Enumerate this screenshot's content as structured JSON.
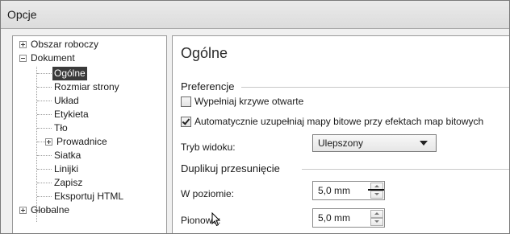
{
  "window": {
    "title": "Opcje"
  },
  "tree": {
    "items": [
      {
        "label": "Obszar roboczy",
        "expander": "plus"
      },
      {
        "label": "Dokument",
        "expander": "minus"
      },
      {
        "label": "Ogólne",
        "selected": true
      },
      {
        "label": "Rozmiar strony"
      },
      {
        "label": "Układ"
      },
      {
        "label": "Etykieta"
      },
      {
        "label": "Tło"
      },
      {
        "label": "Prowadnice",
        "expander": "plus"
      },
      {
        "label": "Siatka"
      },
      {
        "label": "Linijki"
      },
      {
        "label": "Zapisz"
      },
      {
        "label": "Eksportuj HTML"
      },
      {
        "label": "Globalne",
        "expander": "plus"
      }
    ]
  },
  "panel": {
    "title": "Ogólne",
    "preferences_label": "Preferencje",
    "fill_open_curves": {
      "label": "Wypełniaj krzywe otwarte",
      "checked": false
    },
    "auto_bitmaps": {
      "label": "Automatycznie uzupełniaj mapy bitowe przy efektach map bitowych",
      "checked": true
    },
    "view_mode": {
      "label": "Tryb widoku:",
      "value": "Ulepszony"
    },
    "duplicate_label": "Duplikuj przesunięcie",
    "horizontal": {
      "label": "W poziomie:",
      "value": "5,0 mm"
    },
    "vertical": {
      "label": "Pionowo:",
      "value": "5,0 mm"
    }
  }
}
